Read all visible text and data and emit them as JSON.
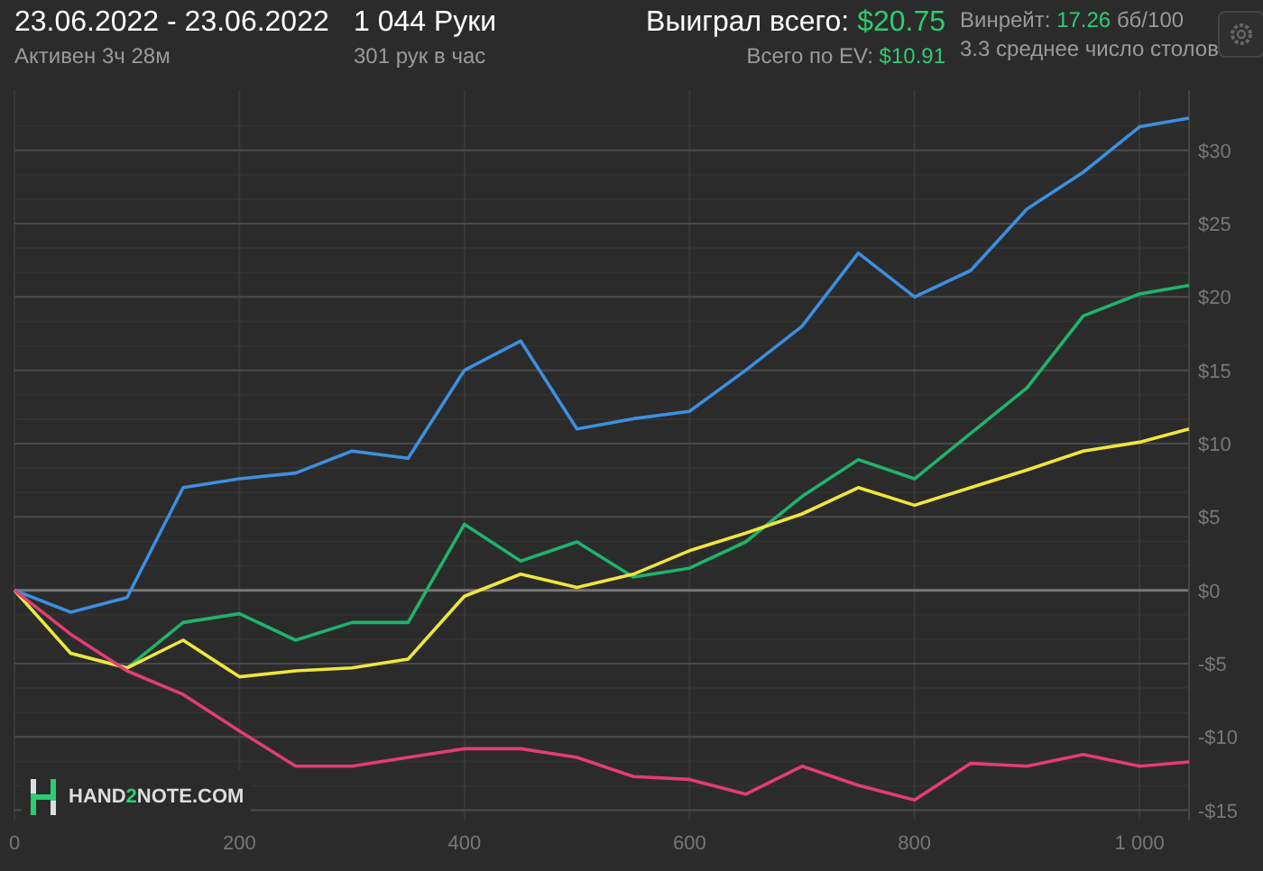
{
  "header": {
    "date_range": "23.06.2022 - 23.06.2022",
    "active_time": "Активен 3ч 28м",
    "hands": "1 044 Руки",
    "hands_per_hour": "301 рук в час",
    "won_label": "Выиграл всего:",
    "won_value": "$20.75",
    "ev_label": "Всего по EV:",
    "ev_value": "$10.91",
    "winrate_label": "Винрейт:",
    "winrate_value": "17.26",
    "winrate_unit": "бб/100",
    "avg_tables": "3.3 среднее число столов"
  },
  "logo": {
    "before": "HAND",
    "accent": "2",
    "after": "NOTE.COM"
  },
  "chart_data": {
    "type": "line",
    "x": [
      0,
      50,
      100,
      150,
      200,
      250,
      300,
      350,
      400,
      450,
      500,
      550,
      600,
      650,
      700,
      750,
      800,
      850,
      900,
      950,
      1000,
      1044
    ],
    "xlim": [
      0,
      1044
    ],
    "ylim": [
      -15.7,
      34.1
    ],
    "grid": true,
    "xticks": [
      0,
      200,
      400,
      600,
      800,
      {
        "value": 1000,
        "label": "1 000"
      }
    ],
    "yticks": [
      {
        "value": -15,
        "label": "-$15"
      },
      {
        "value": -10,
        "label": "-$10"
      },
      {
        "value": -5,
        "label": "-$5"
      },
      {
        "value": 0,
        "label": "$0"
      },
      {
        "value": 5,
        "label": "$5"
      },
      {
        "value": 10,
        "label": "$10"
      },
      {
        "value": 15,
        "label": "$15"
      },
      {
        "value": 20,
        "label": "$20"
      },
      {
        "value": 25,
        "label": "$25"
      },
      {
        "value": 30,
        "label": "$30"
      }
    ],
    "series": [
      {
        "color": "#3d8fe0",
        "values": [
          0,
          -1.5,
          -0.5,
          7,
          7.6,
          8,
          9.5,
          9,
          15,
          17,
          11,
          11.7,
          12.2,
          15,
          18,
          23,
          20,
          21.8,
          26,
          28.5,
          31.6,
          32.2
        ]
      },
      {
        "color": "#1fb36b",
        "values": [
          0,
          -4.3,
          -5.3,
          -2.2,
          -1.6,
          -3.4,
          -2.2,
          -2.2,
          4.5,
          2,
          3.3,
          0.9,
          1.5,
          3.3,
          6.4,
          8.9,
          7.6,
          10.7,
          13.8,
          18.7,
          20.2,
          20.8
        ]
      },
      {
        "color": "#f0e63c",
        "values": [
          0,
          -4.3,
          -5.3,
          -3.4,
          -5.9,
          -5.5,
          -5.3,
          -4.7,
          -0.4,
          1.1,
          0.2,
          1.1,
          2.7,
          3.9,
          5.2,
          7,
          5.8,
          7,
          8.2,
          9.5,
          10.1,
          11
        ]
      },
      {
        "color": "#e23d72",
        "values": [
          0,
          -3,
          -5.5,
          -7.1,
          -9.6,
          -12,
          -12,
          -11.4,
          -10.8,
          -10.8,
          -11.4,
          -12.7,
          -12.9,
          -13.9,
          -12,
          -13.3,
          -14.3,
          -11.8,
          -12,
          -11.2,
          -12,
          -11.7
        ]
      }
    ]
  }
}
